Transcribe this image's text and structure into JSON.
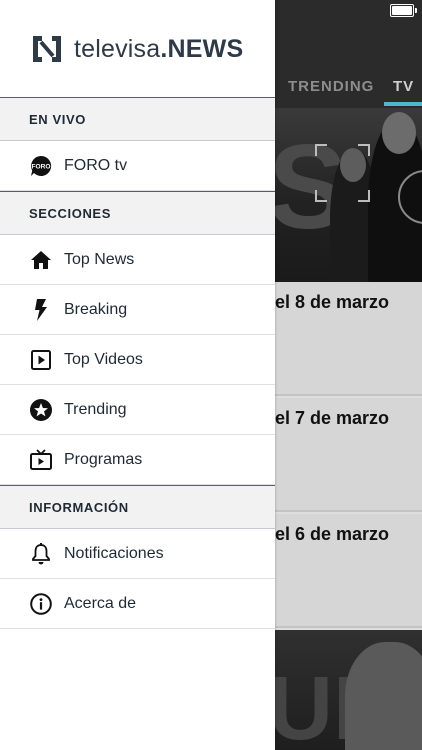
{
  "brand": {
    "name_light": "televisa",
    "name_bold": ".NEWS"
  },
  "background": {
    "logo_tail": "S",
    "tabs": [
      {
        "label": "TRENDING"
      },
      {
        "label": "TV"
      }
    ],
    "hero_letter": "S",
    "rows": [
      {
        "date": "el 8 de marzo"
      },
      {
        "date": "el 7 de marzo"
      },
      {
        "date": "el 6 de marzo"
      }
    ],
    "footer_letters": "UN"
  },
  "drawer": {
    "sections": {
      "live": {
        "title": "EN VIVO",
        "items": [
          {
            "label": "FORO tv",
            "icon": "foro-tv-icon",
            "icon_text": "FORO"
          }
        ]
      },
      "sections": {
        "title": "SECCIONES",
        "items": [
          {
            "label": "Top News",
            "icon": "home-icon"
          },
          {
            "label": "Breaking",
            "icon": "lightning-icon"
          },
          {
            "label": "Top Videos",
            "icon": "play-square-icon"
          },
          {
            "label": "Trending",
            "icon": "star-circle-icon"
          },
          {
            "label": "Programas",
            "icon": "tv-icon"
          }
        ]
      },
      "info": {
        "title": "INFORMACIÓN",
        "items": [
          {
            "label": "Notificaciones",
            "icon": "bell-icon"
          },
          {
            "label": "Acerca de",
            "icon": "info-icon"
          }
        ]
      }
    }
  },
  "colors": {
    "text_dark": "#1f2a35",
    "accent_tab": "#4fb7c9",
    "header_bg": "#2b2b2b"
  }
}
